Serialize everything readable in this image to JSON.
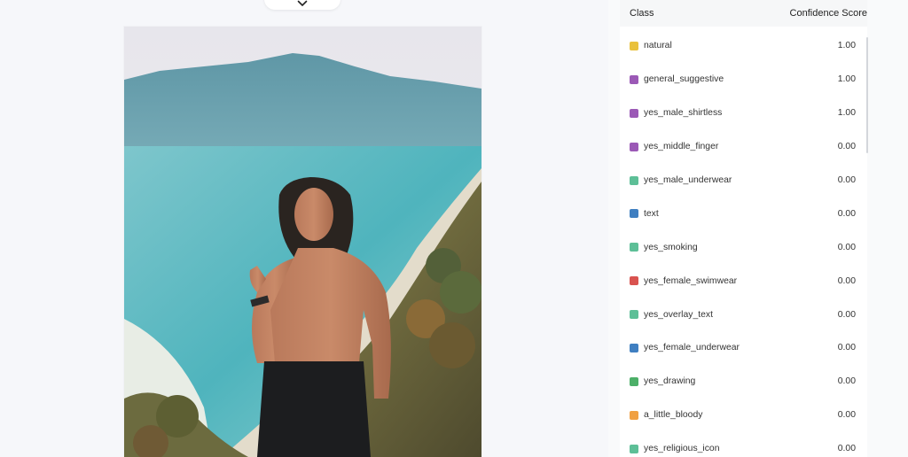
{
  "header": {
    "class_label": "Class",
    "score_label": "Confidence Score"
  },
  "image": {
    "alt": "Classified image"
  },
  "classes": [
    {
      "name": "natural",
      "score": "1.00",
      "color": "#e9c13c"
    },
    {
      "name": "general_suggestive",
      "score": "1.00",
      "color": "#9b59b6"
    },
    {
      "name": "yes_male_shirtless",
      "score": "1.00",
      "color": "#9b59b6"
    },
    {
      "name": "yes_middle_finger",
      "score": "0.00",
      "color": "#9b59b6"
    },
    {
      "name": "yes_male_underwear",
      "score": "0.00",
      "color": "#5dbf97"
    },
    {
      "name": "text",
      "score": "0.00",
      "color": "#3f7fc1"
    },
    {
      "name": "yes_smoking",
      "score": "0.00",
      "color": "#5dbf97"
    },
    {
      "name": "yes_female_swimwear",
      "score": "0.00",
      "color": "#d9534f"
    },
    {
      "name": "yes_overlay_text",
      "score": "0.00",
      "color": "#5dbf97"
    },
    {
      "name": "yes_female_underwear",
      "score": "0.00",
      "color": "#3f7fc1"
    },
    {
      "name": "yes_drawing",
      "score": "0.00",
      "color": "#4caf68"
    },
    {
      "name": "a_little_bloody",
      "score": "0.00",
      "color": "#f0a042"
    },
    {
      "name": "yes_religious_icon",
      "score": "0.00",
      "color": "#5dbf97"
    }
  ]
}
